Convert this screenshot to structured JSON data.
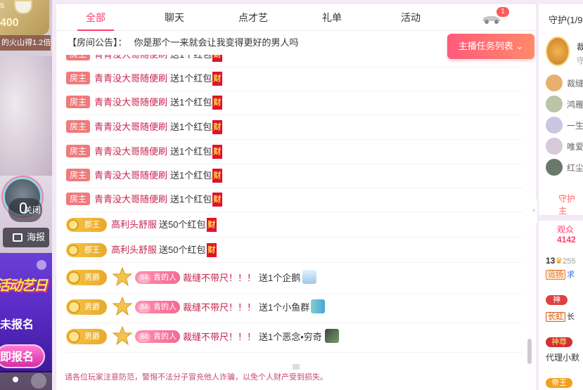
{
  "left_video": {
    "badge_prefix": "s",
    "badge_number": "400",
    "fire_text": "的火山得1.2倍",
    "mic_label": "关闭",
    "poster_label": "海报",
    "ad_title": "活动艺日",
    "ad_mid": "未报名",
    "ad_button": "即报名"
  },
  "tabs": [
    {
      "label": "全部",
      "active": true
    },
    {
      "label": "聊天",
      "active": false
    },
    {
      "label": "点才艺",
      "active": false
    },
    {
      "label": "礼单",
      "active": false
    },
    {
      "label": "活动",
      "active": false
    }
  ],
  "car_badge_count": "1",
  "notice": {
    "tag": "【房间公告】：",
    "text": "你是那个一来就会让我变得更好的男人吗"
  },
  "task_button": "主播任务列表",
  "messages": [
    {
      "badge": "房主",
      "user": "青青没大哥随便刷",
      "text": "送1个红包",
      "gift": "财"
    },
    {
      "badge": "房主",
      "user": "青青没大哥随便刷",
      "text": "送1个红包",
      "gift": "财"
    },
    {
      "badge": "房主",
      "user": "青青没大哥随便刷",
      "text": "送1个红包",
      "gift": "财"
    },
    {
      "badge": "房主",
      "user": "青青没大哥随便刷",
      "text": "送1个红包",
      "gift": "财"
    },
    {
      "badge": "房主",
      "user": "青青没大哥随便刷",
      "text": "送1个红包",
      "gift": "财"
    },
    {
      "badge": "房主",
      "user": "青青没大哥随便刷",
      "text": "送1个红包",
      "gift": "财"
    },
    {
      "badge": "房主",
      "user": "青青没大哥随便刷",
      "text": "送1个红包",
      "gift": "财"
    },
    {
      "badge": "郡王",
      "user": "高利头舒服",
      "text": "送50个红包",
      "gift": "财"
    },
    {
      "badge": "郡王",
      "user": "高利头舒服",
      "text": "送50个红包",
      "gift": "财"
    }
  ],
  "gift_messages": [
    {
      "badge": "男爵",
      "level": "84",
      "level_label": "青的人",
      "user": "裁缝不带尺！！！",
      "text": "送1个企鹅"
    },
    {
      "badge": "男爵",
      "level": "84",
      "level_label": "青的人",
      "user": "裁缝不带尺！！！",
      "text": "送1个小鱼群"
    },
    {
      "badge": "男爵",
      "level": "84",
      "level_label": "青的人",
      "user": "裁缝不带尺！！！",
      "text": "送1个恶念•穷奇"
    }
  ],
  "footer_tip": "请各位玩家注意防范，警惕不法分子冒充他人诈骗，以免个人财产受到损失。",
  "right": {
    "guard_title": "守护",
    "guard_count": "(1/9",
    "guard_top_name": "裁",
    "guard_top_sub": "守",
    "guard_list": [
      "裁缝",
      "鸿雁",
      "一生",
      "唯爱",
      "红尘"
    ],
    "guard_link": "守护主",
    "viewers_label": "观众",
    "viewers_count": "4142",
    "viewer_rows": [
      {
        "prefix": "13",
        "suffix": "255",
        "tag": "远扬",
        "name": "求"
      },
      {
        "tag": "神",
        "name": ""
      },
      {
        "tag": "长虹",
        "name": "长"
      },
      {
        "tag": "神尊",
        "name": ""
      },
      {
        "tag": "",
        "name": "代理小默"
      },
      {
        "tag": "帝王",
        "name": ""
      }
    ]
  }
}
